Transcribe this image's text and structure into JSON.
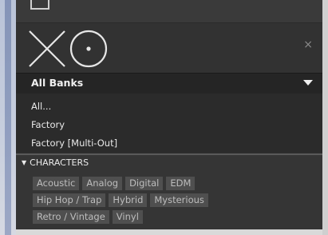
{
  "window": {
    "close_label": "×"
  },
  "banks": {
    "selected": "All Banks"
  },
  "bank_options": [
    "All...",
    "Factory",
    "Factory [Multi-Out]"
  ],
  "characters": {
    "header": "CHARACTERS",
    "rows": [
      [
        "Acoustic",
        "Analog",
        "Digital",
        "EDM"
      ],
      [
        "Hip Hop / Trap",
        "Hybrid",
        "Mysterious"
      ],
      [
        "Retro / Vintage",
        "Vinyl"
      ]
    ]
  },
  "icons": {
    "logo": "xo-logo",
    "close": "close-icon",
    "dropdown": "dropdown-arrow-icon",
    "collapse": "triangle-down-icon"
  },
  "colors": {
    "panel": "#2f2f2f",
    "chip": "#4f4f4f",
    "text": "#e8e8e8",
    "tag_text": "#bdbdbd"
  }
}
